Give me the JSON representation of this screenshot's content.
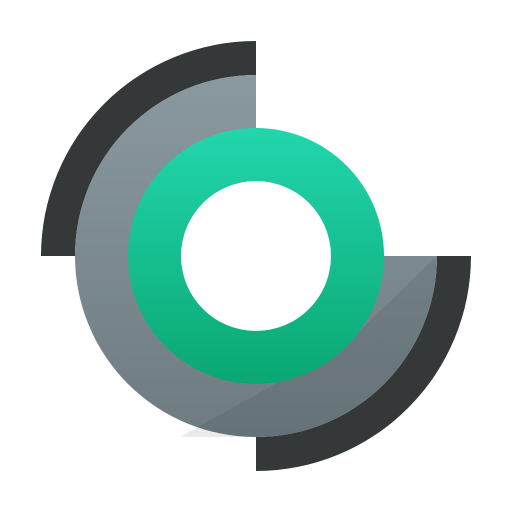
{
  "app_icon": {
    "icon_name": "timeshift-style-restore-logo-icon",
    "colors": {
      "outer_arc": "#353839",
      "outer_arc_highlight": "#4a4e50",
      "middle_disc_top": "#8a999f",
      "middle_disc_bottom": "#6e7c82",
      "inner_ring_top": "#22d6ad",
      "inner_ring_bottom": "#0aa772",
      "center_hole": "#ffffff",
      "background": "#ffffff"
    }
  }
}
